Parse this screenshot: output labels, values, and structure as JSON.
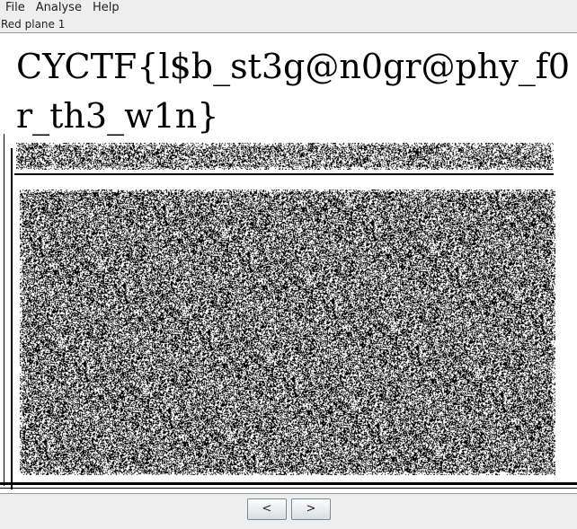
{
  "menu": {
    "items": [
      "File",
      "Analyse",
      "Help"
    ]
  },
  "plane_label": "Red plane 1",
  "image": {
    "flag_text": "CYCTF{l$b_st3g@n0gr@phy_f0r_th3_w1n}"
  },
  "nav": {
    "prev_label": "<",
    "next_label": ">"
  },
  "colors": {
    "background": "#eeeeee",
    "panel": "#ffffff",
    "ink": "#000000"
  }
}
